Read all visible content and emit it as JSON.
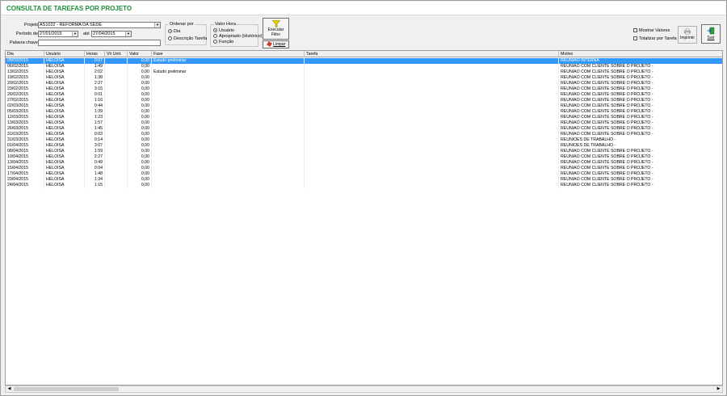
{
  "window": {
    "title": "CONSULTA DE TAREFAS POR PROJETO"
  },
  "filters": {
    "projeto_label": "Projeto",
    "projeto_value": "AS1022 - REFORMA DA SEDE",
    "periodo_label": "Período de",
    "periodo_from": "27/01/2015",
    "ate_label": "até",
    "periodo_to": "27/04/2015",
    "palavra_label": "Palavra chave",
    "palavra_value": ""
  },
  "ordenar": {
    "title": "Ordenar por",
    "options": [
      "Dia",
      "Descrição Tarefa"
    ],
    "selected": "Dia"
  },
  "valor_hora": {
    "title": "Valor Hora",
    "options": [
      "Usuário",
      "Apropriado (Histórico)",
      "Função"
    ],
    "selected": "Usuário"
  },
  "actions": {
    "executar_label": "Executar Filtro",
    "limpar_label": "Limpar",
    "mostrar_valores_label": "Mostrar Valores",
    "totalizar_label": "Totalizar por Tarefa",
    "imprimir_label": "Imprimir",
    "sair_label": "Sair"
  },
  "icons": {
    "filter": "filter-funnel-icon",
    "clear": "eraser-icon",
    "print": "printer-icon",
    "exit": "exit-door-icon"
  },
  "colors": {
    "title": "#1e8f3a",
    "selection": "#3399ff"
  },
  "table": {
    "columns": [
      "Dia",
      "Usuário",
      "Horas",
      "Vlr Unit.",
      "Valor",
      "Fase",
      "Tarefa",
      "Motivo"
    ],
    "rows": [
      [
        "05/02/2015",
        "HELOISA",
        "0:07",
        "",
        "0,00",
        "Estudo preliminar",
        "",
        "REUNIÃO INTERNA"
      ],
      [
        "06/02/2015",
        "HELOISA",
        "1:49",
        "",
        "0,00",
        "",
        "",
        "REUNIÃO COM CLIENTE SOBRE O PROJETO -"
      ],
      [
        "13/02/2015",
        "HELOISA",
        "2:02",
        "",
        "0,00",
        "Estudo preliminar",
        "",
        "REUNIÃO COM CLIENTE SOBRE O PROJETO -"
      ],
      [
        "19/02/2015",
        "HELOISA",
        "1:38",
        "",
        "0,00",
        "",
        "",
        "REUNIÃO COM CLIENTE SOBRE O PROJETO -"
      ],
      [
        "20/02/2015",
        "HELOISA",
        "2:27",
        "",
        "0,00",
        "",
        "",
        "REUNIÃO COM CLIENTE SOBRE O PROJETO -"
      ],
      [
        "23/02/2015",
        "HELOISA",
        "3:15",
        "",
        "0,00",
        "",
        "",
        "REUNIÃO COM CLIENTE SOBRE O PROJETO -"
      ],
      [
        "26/02/2015",
        "HELOISA",
        "0:01",
        "",
        "0,00",
        "",
        "",
        "REUNIÃO COM CLIENTE SOBRE O PROJETO -"
      ],
      [
        "27/02/2015",
        "HELOISA",
        "1:16",
        "",
        "0,00",
        "",
        "",
        "REUNIÃO COM CLIENTE SOBRE O PROJETO -"
      ],
      [
        "02/03/2015",
        "HELOISA",
        "0:44",
        "",
        "0,00",
        "",
        "",
        "REUNIÃO COM CLIENTE SOBRE O PROJETO -"
      ],
      [
        "05/03/2015",
        "HELOISA",
        "1:39",
        "",
        "0,00",
        "",
        "",
        "REUNIÃO COM CLIENTE SOBRE O PROJETO -"
      ],
      [
        "12/03/2015",
        "HELOISA",
        "1:23",
        "",
        "0,00",
        "",
        "",
        "REUNIÃO COM CLIENTE SOBRE O PROJETO -"
      ],
      [
        "13/03/2015",
        "HELOISA",
        "1:57",
        "",
        "0,00",
        "",
        "",
        "REUNIÃO COM CLIENTE SOBRE O PROJETO -"
      ],
      [
        "26/03/2015",
        "HELOISA",
        "1:45",
        "",
        "0,00",
        "",
        "",
        "REUNIÃO COM CLIENTE SOBRE O PROJETO -"
      ],
      [
        "31/03/2015",
        "HELOISA",
        "0:03",
        "",
        "0,00",
        "",
        "",
        "REUNIÃO COM CLIENTE SOBRE O PROJETO -"
      ],
      [
        "31/03/2015",
        "HELOISA",
        "0:14",
        "",
        "0,00",
        "",
        "",
        "REUNIÕES DE TRABALHO -"
      ],
      [
        "01/04/2015",
        "HELOISA",
        "3:07",
        "",
        "0,00",
        "",
        "",
        "REUNIÕES DE TRABALHO -"
      ],
      [
        "08/04/2015",
        "HELOISA",
        "1:59",
        "",
        "0,00",
        "",
        "",
        "REUNIÃO COM CLIENTE SOBRE O PROJETO -"
      ],
      [
        "10/04/2015",
        "HELOISA",
        "2:27",
        "",
        "0,00",
        "",
        "",
        "REUNIÃO COM CLIENTE SOBRE O PROJETO -"
      ],
      [
        "13/04/2015",
        "HELOISA",
        "0:49",
        "",
        "0,00",
        "",
        "",
        "REUNIÃO COM CLIENTE SOBRE O PROJETO -"
      ],
      [
        "15/04/2015",
        "HELOISA",
        "0:04",
        "",
        "0,00",
        "",
        "",
        "REUNIÃO COM CLIENTE SOBRE O PROJETO -"
      ],
      [
        "17/04/2015",
        "HELOISA",
        "1:48",
        "",
        "0,00",
        "",
        "",
        "REUNIÃO COM CLIENTE SOBRE O PROJETO -"
      ],
      [
        "23/04/2015",
        "HELOISA",
        "1:34",
        "",
        "0,00",
        "",
        "",
        "REUNIÃO COM CLIENTE SOBRE O PROJETO -"
      ],
      [
        "24/04/2015",
        "HELOISA",
        "1:15",
        "",
        "0,00",
        "",
        "",
        "REUNIÃO COM CLIENTE SOBRE O PROJETO -"
      ]
    ],
    "selected_row": 0
  }
}
